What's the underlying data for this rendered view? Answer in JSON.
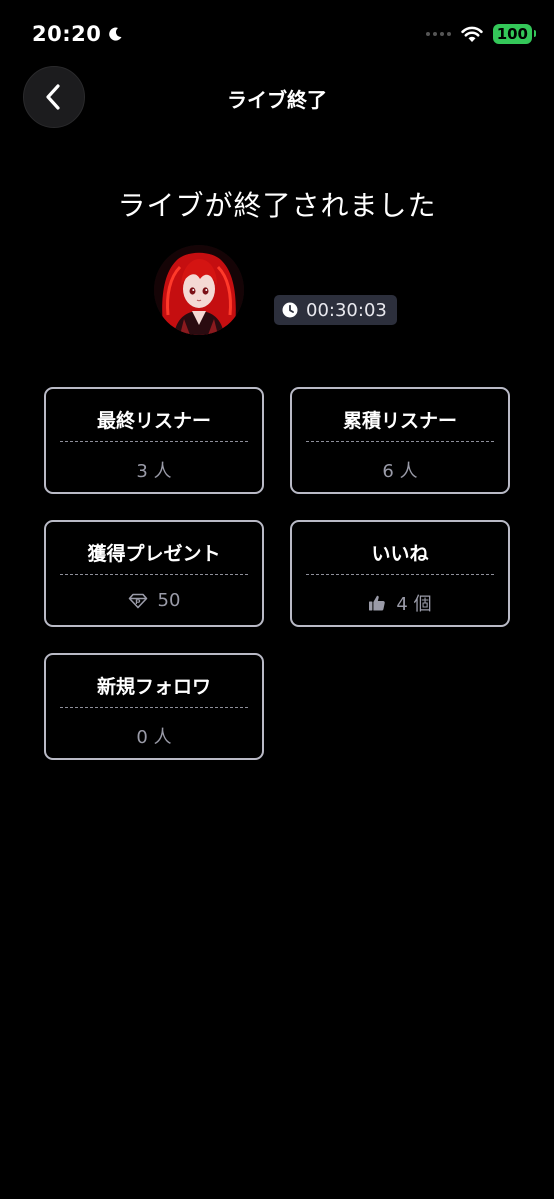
{
  "status_bar": {
    "time": "20:20",
    "battery": "100"
  },
  "header": {
    "title": "ライブ終了"
  },
  "main": {
    "ended_message": "ライブが終了されました",
    "duration": "00:30:03"
  },
  "stats": [
    {
      "label": "最終リスナー",
      "value": "3 人"
    },
    {
      "label": "累積リスナー",
      "value": "6 人"
    },
    {
      "label": "獲得プレゼント",
      "value": "50",
      "icon": "gem-icon"
    },
    {
      "label": "いいね",
      "value": "4 個",
      "icon": "thumbs-up-icon"
    },
    {
      "label": "新規フォロワ",
      "value": "0 人"
    }
  ],
  "colors": {
    "background": "#000000",
    "card_border": "#b9bac6",
    "badge_bg": "#2c2f3c",
    "battery": "#34c759",
    "avatar_hair": "#d01010"
  }
}
